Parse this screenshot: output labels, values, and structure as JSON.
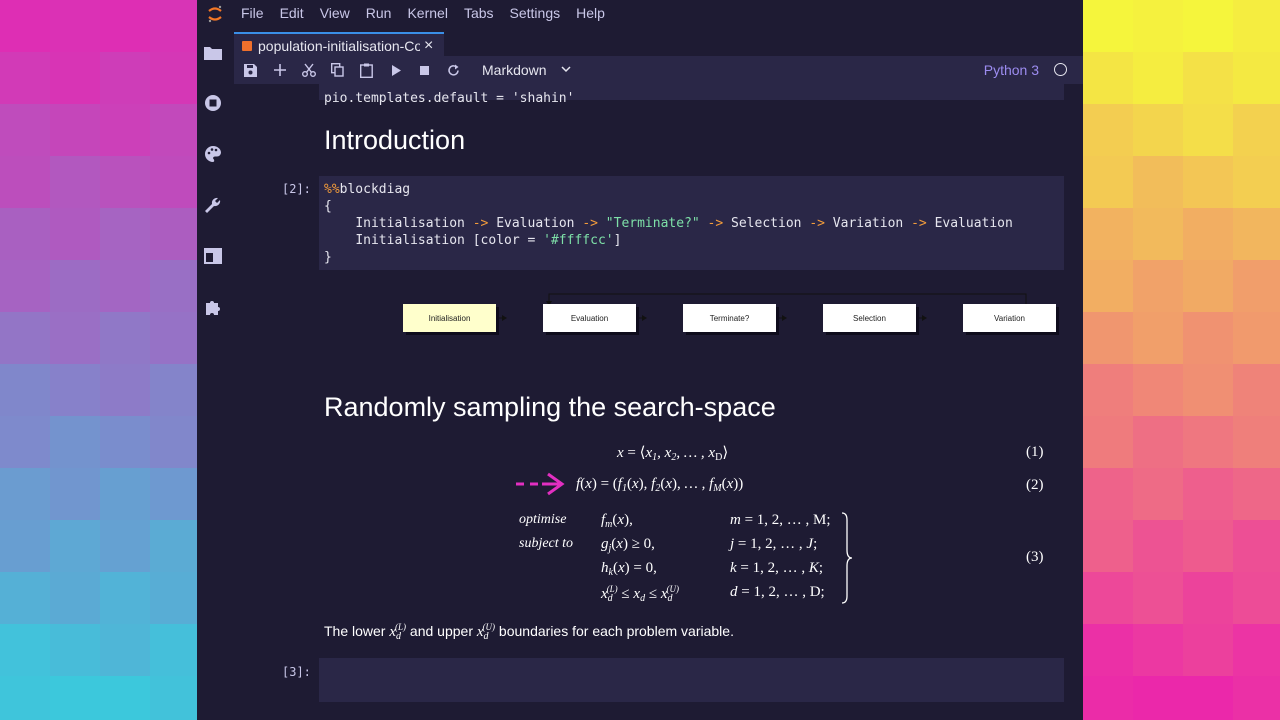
{
  "menu": [
    "File",
    "Edit",
    "View",
    "Run",
    "Kernel",
    "Tabs",
    "Settings",
    "Help"
  ],
  "tab": {
    "title": "population-initialisation-Co",
    "close": "×"
  },
  "toolbar": {
    "cell_type": "Markdown",
    "kernel": "Python 3"
  },
  "cells": {
    "partial_line": "pio.templates.default = 'shahin'",
    "intro_heading": "Introduction",
    "cell2_prompt": "[2]:",
    "cell2": {
      "magic": "%%",
      "magic_name": "blockdiag",
      "open": "{",
      "close": "}",
      "line1": [
        "Initialisation",
        "->",
        "Evaluation",
        "->",
        "\"Terminate?\"",
        "->",
        "Selection",
        "->",
        "Variation",
        "->",
        "Evaluation"
      ],
      "line2_prefix": "Initialisation [color = ",
      "line2_value": "'#ffffcc'",
      "line2_suffix": "]"
    },
    "diagram_nodes": [
      "Initialisation",
      "Evaluation",
      "Terminate?",
      "Selection",
      "Variation"
    ],
    "section_heading": "Randomly sampling the search-space",
    "eq_numbers": [
      "(1)",
      "(2)",
      "(3)"
    ],
    "opt_labels": [
      "optimise",
      "subject to"
    ],
    "paragraph": {
      "a": "The lower ",
      "b": " and upper ",
      "c": " boundaries for each problem variable."
    },
    "cell3_prompt": "[3]:"
  },
  "colors": {
    "accent": "#3a8fe8",
    "annotation_arrow": "#e22fc1",
    "node_highlight": "#ffffcc"
  }
}
